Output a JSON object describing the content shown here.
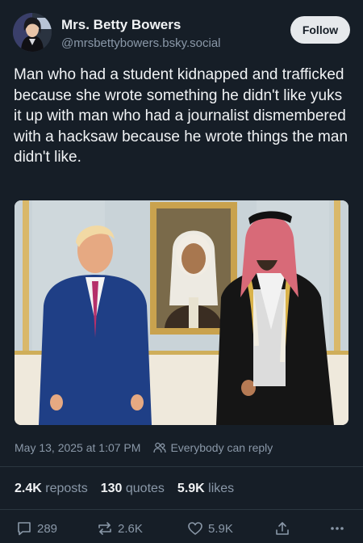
{
  "author": {
    "name": "Mrs. Betty Bowers",
    "handle": "@mrsbettybowers.bsky.social"
  },
  "follow_label": "Follow",
  "post": {
    "text": "Man who had a student kidnapped and trafficked because she wrote something he didn't like yuks it up with man who had a journalist dismembered with a hacksaw because he wrote things the man didn't like."
  },
  "meta": {
    "timestamp": "May 13, 2025 at 1:07 PM",
    "reply_setting": "Everybody can reply"
  },
  "stats": {
    "reposts_count": "2.4K",
    "reposts_label": "reposts",
    "quotes_count": "130",
    "quotes_label": "quotes",
    "likes_count": "5.9K",
    "likes_label": "likes"
  },
  "actions": {
    "replies": "289",
    "reposts": "2.6K",
    "likes": "5.9K"
  },
  "icons": [
    "reply-icon",
    "repost-icon",
    "like-icon",
    "share-icon",
    "more-icon",
    "people-icon"
  ],
  "colors": {
    "background": "#161e27",
    "text": "#f1f3f5",
    "muted": "#8a98a8",
    "follow_bg": "#e6e9ec"
  }
}
